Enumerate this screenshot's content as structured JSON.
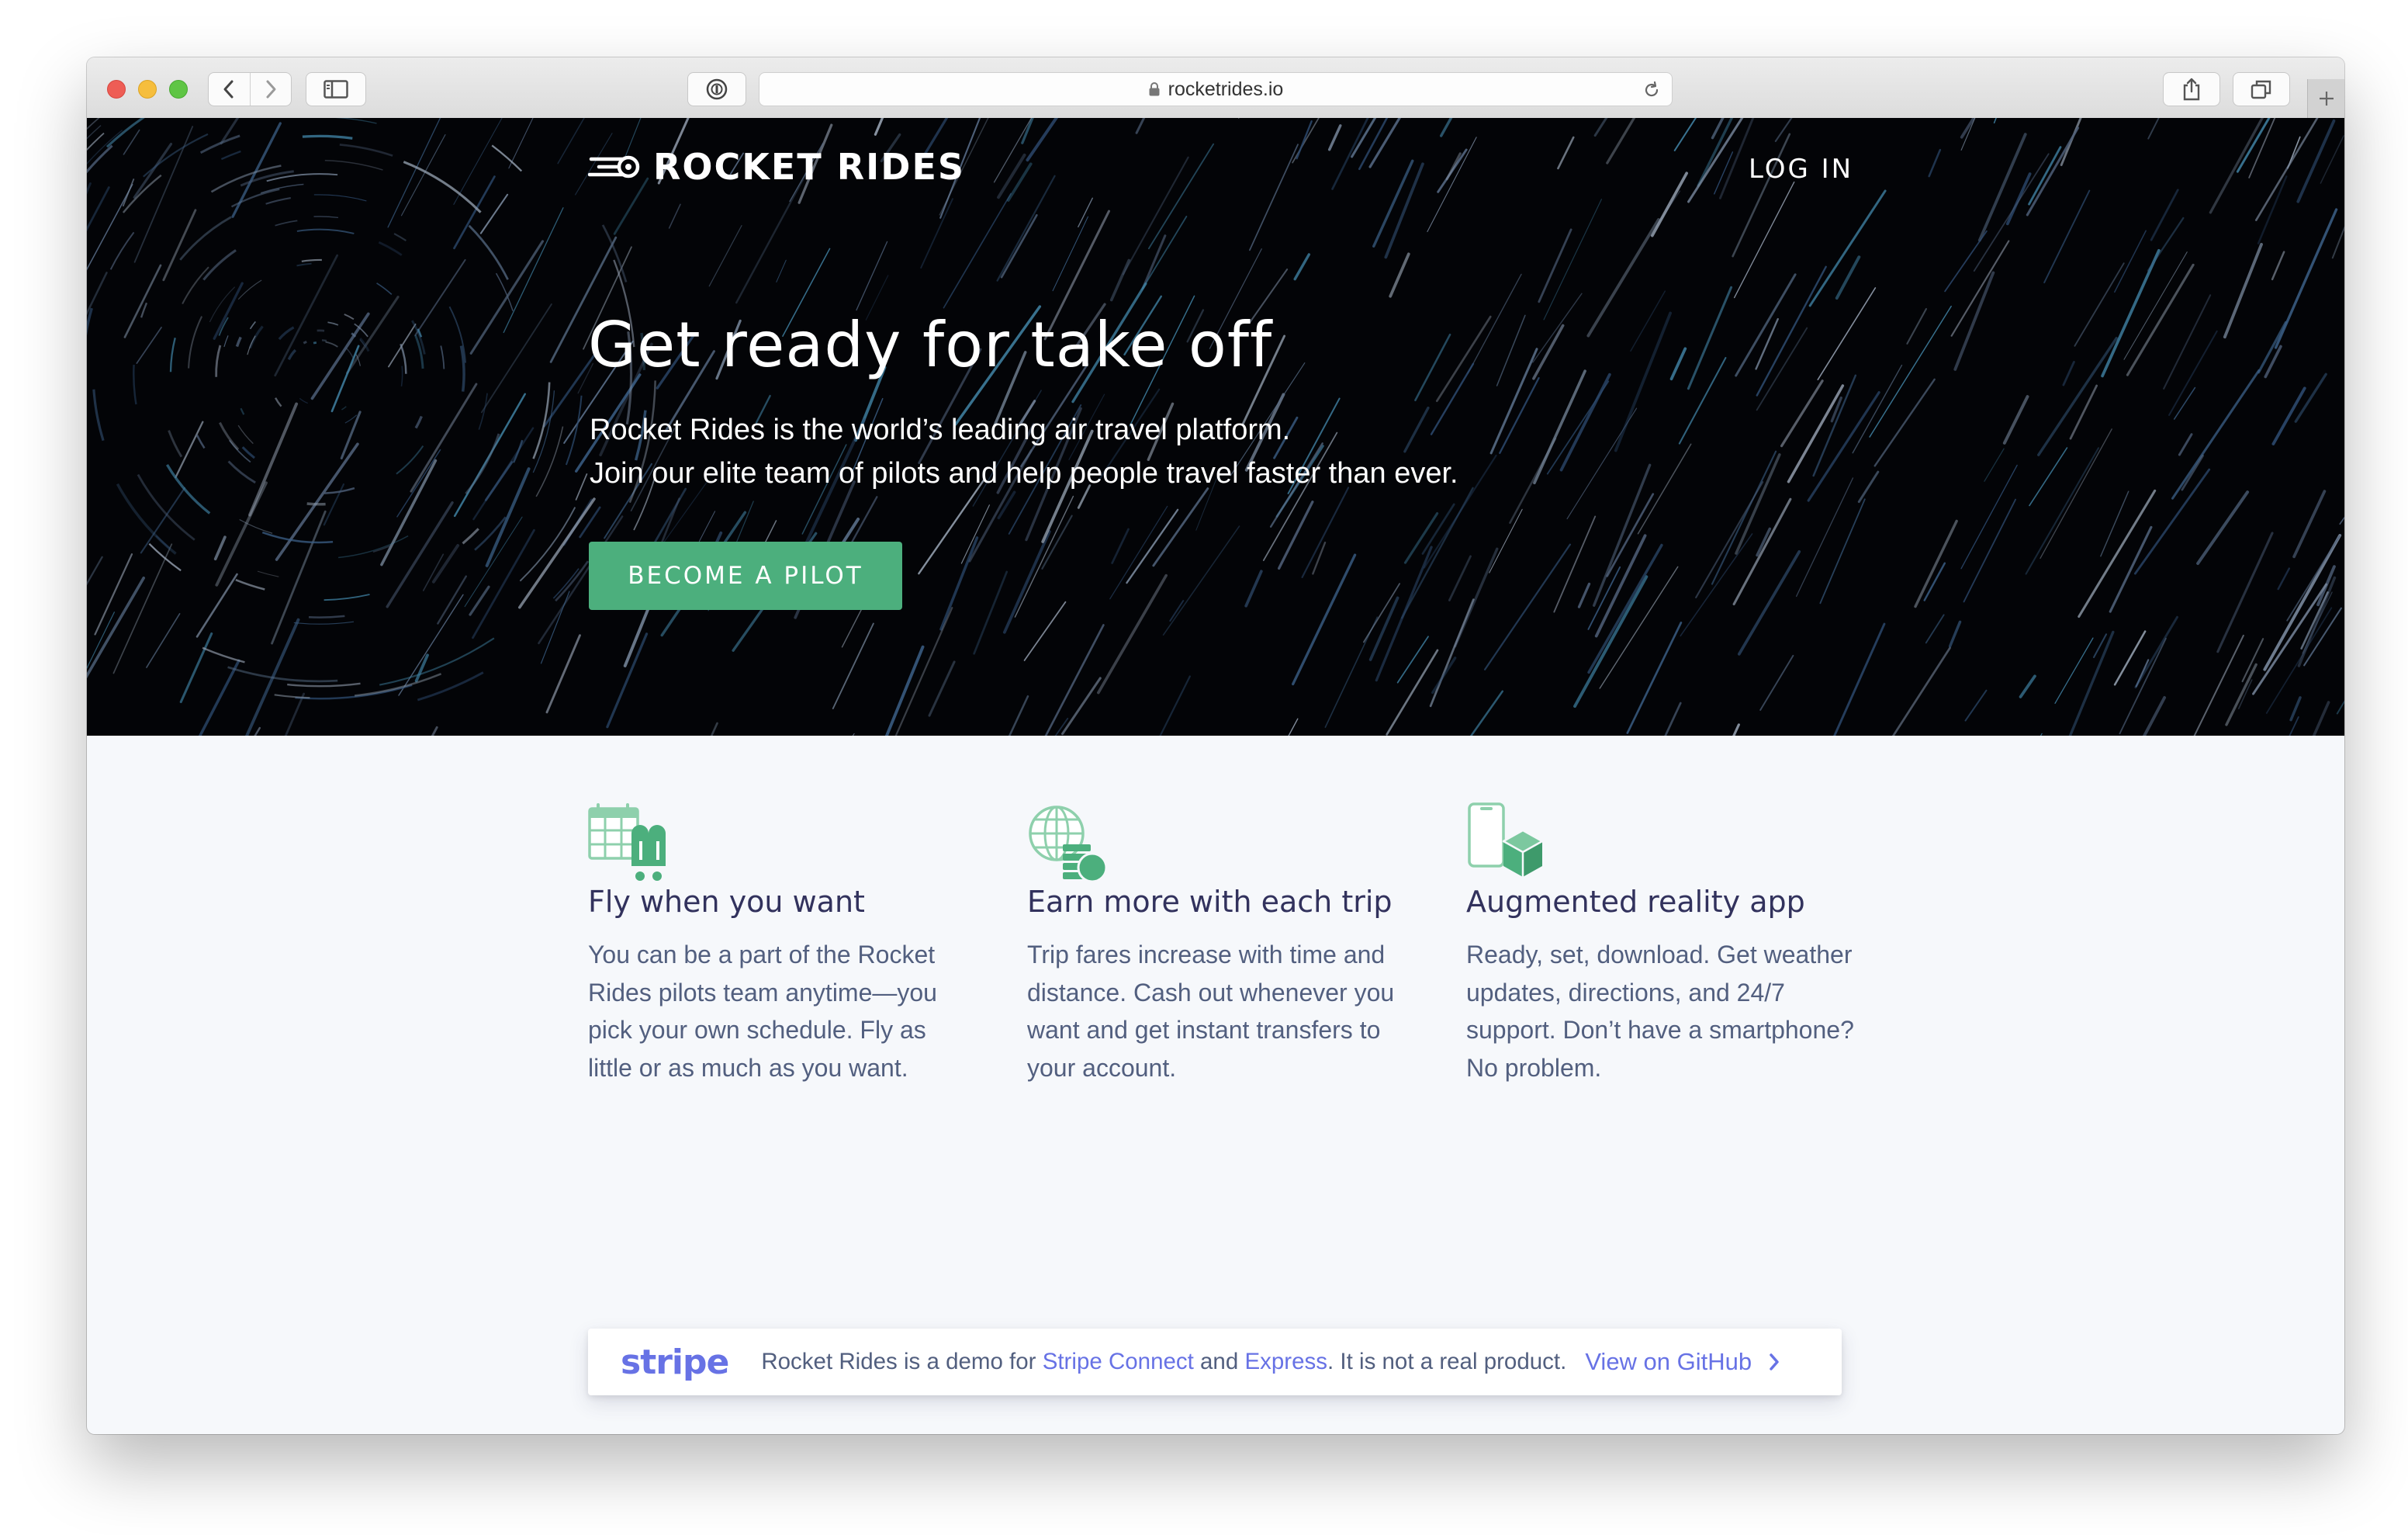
{
  "browser": {
    "url": "rocketrides.io"
  },
  "header": {
    "logo_text": "ROCKET RIDES",
    "login_label": "LOG IN"
  },
  "hero": {
    "title": "Get ready for take off",
    "subtitle_line1": "Rocket Rides is the world’s leading air travel platform.",
    "subtitle_line2": "Join our elite team of pilots and help people travel faster than ever.",
    "cta_label": "BECOME A PILOT"
  },
  "features": [
    {
      "icon": "calendar-rocket-icon",
      "title": "Fly when you want",
      "text": "You can be a part of the Rocket Rides pilots team anytime—you pick your own schedule. Fly as little or as much as you want."
    },
    {
      "icon": "globe-coins-icon",
      "title": "Earn more with each trip",
      "text": "Trip fares increase with time and distance. Cash out whenever you want and get instant transfers to your account."
    },
    {
      "icon": "phone-cube-icon",
      "title": "Augmented reality app",
      "text": "Ready, set, download. Get weather updates, directions, and 24/7 support. Don’t have a smartphone? No problem."
    }
  ],
  "banner": {
    "brand": "stripe",
    "text_before": "Rocket Rides is a demo for ",
    "link_connect": "Stripe Connect",
    "text_and": " and ",
    "link_express": "Express",
    "text_after": ". It is not a real product.",
    "github_label": "View on GitHub"
  },
  "colors": {
    "accent_green": "#4caf7d",
    "stripe_purple": "#6772e5",
    "heading": "#32325d",
    "body_text": "#525f7f",
    "hero_bg": "#030407"
  }
}
